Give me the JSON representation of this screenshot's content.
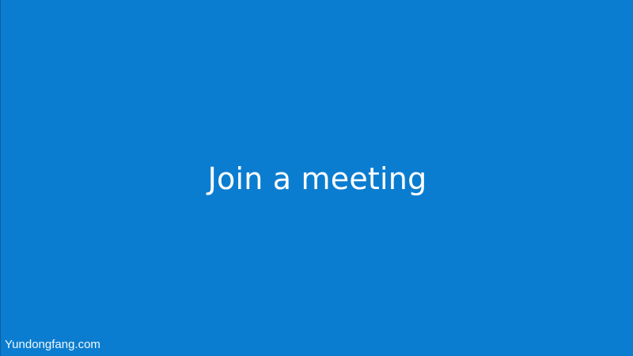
{
  "screen": {
    "title": "Join a meeting",
    "watermark": "Yundongfang.com",
    "background_color": "#0b7dd0",
    "text_color": "#ffffff"
  }
}
